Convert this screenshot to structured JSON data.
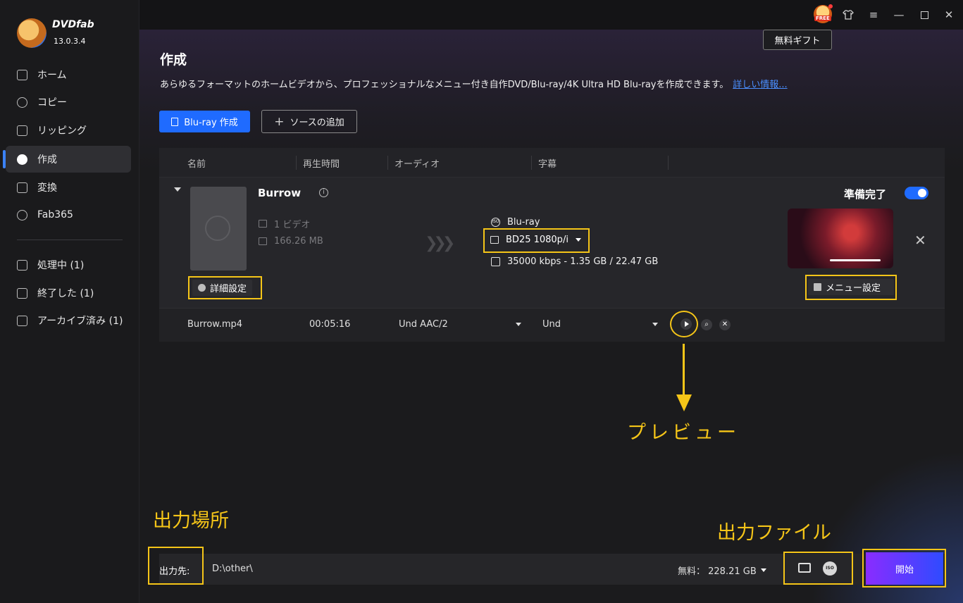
{
  "app": {
    "name": "DVDfab",
    "version": "13.0.3.4"
  },
  "sidebar": {
    "items": [
      {
        "label": "ホーム",
        "icon": "home-icon"
      },
      {
        "label": "コピー",
        "icon": "copy-icon"
      },
      {
        "label": "リッピング",
        "icon": "ripping-icon"
      },
      {
        "label": "作成",
        "icon": "create-icon",
        "active": true
      },
      {
        "label": "変換",
        "icon": "convert-icon"
      },
      {
        "label": "Fab365",
        "icon": "fab365-icon"
      }
    ],
    "tasks": [
      {
        "label": "処理中 (1)",
        "icon": "processing-icon"
      },
      {
        "label": "終了した (1)",
        "icon": "finished-icon"
      },
      {
        "label": "アーカイブ済み (1)",
        "icon": "archive-icon"
      }
    ]
  },
  "topbar": {
    "free_badge": "FREE",
    "gift_tooltip": "無料ギフト",
    "icons": [
      "free-gift-icon",
      "shirt-skin-icon",
      "menu-icon",
      "minimize-icon",
      "maximize-icon",
      "close-icon"
    ]
  },
  "header": {
    "title": "作成",
    "description": "あらゆるフォーマットのホームビデオから、プロフェッショナルなメニュー付き自作DVD/Blu-ray/4K Ultra HD Blu-rayを作成できます。",
    "more_link": "詳しい情報..."
  },
  "toolbar": {
    "create_label": "Blu-ray 作成",
    "add_source_label": "ソースの追加",
    "add_symbol": "+"
  },
  "table": {
    "columns": [
      "名前",
      "再生時間",
      "オーディオ",
      "字幕"
    ],
    "item": {
      "title": "Burrow",
      "video_count": "1 ビデオ",
      "size": "166.26 MB",
      "output_type": "Blu-ray",
      "format": "BD25 1080p/i",
      "bitrate_info": "35000 kbps - 1.35 GB / 22.47 GB",
      "ready_label": "準備完了",
      "ready_enabled": true,
      "detail_button": "詳細設定",
      "menu_button": "メニュー設定",
      "file_name": "Burrow.mp4",
      "duration": "00:05:16",
      "audio": "Und  AAC/2",
      "subtitle": "Und"
    }
  },
  "bottom": {
    "output_label": "出力先:",
    "output_path": "D:\\other\\",
    "free_space": "無料：  228.21 GB",
    "start_button": "開始",
    "iso_label": "ISO"
  },
  "annotations": {
    "preview": "プレビュー",
    "output_location": "出力場所",
    "output_file": "出力ファイル"
  },
  "colors": {
    "accent_blue": "#1f6bff",
    "highlight_yellow": "#f5c518",
    "start_gradient_from": "#8a2cff",
    "start_gradient_to": "#2f4bff"
  }
}
